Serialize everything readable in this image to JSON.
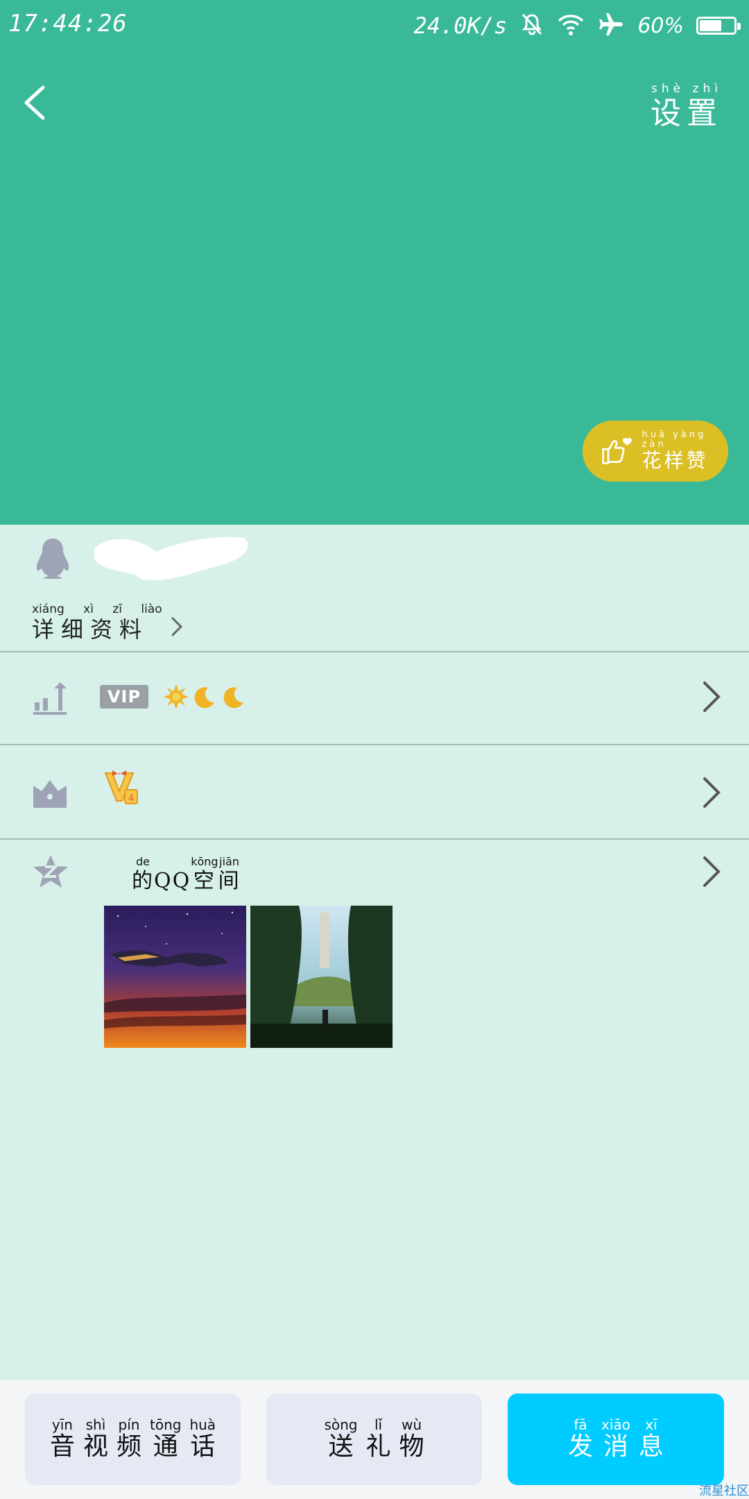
{
  "status_bar": {
    "time": "17:44:26",
    "speed": "24.0K/s",
    "battery_pct": "60%",
    "battery_level": 0.6,
    "icons": [
      "bell-off-icon",
      "wifi-icon",
      "airplane-icon",
      "battery-icon"
    ]
  },
  "header": {
    "settings": {
      "pinyin": "shè zhì",
      "label": "设置"
    },
    "like": {
      "pinyin": "huā yàng zàn",
      "label": "花样赞"
    },
    "colors": {
      "bg": "#39b998",
      "like_bg": "#dcbf25"
    }
  },
  "profile": {
    "detail": {
      "pinyin": "xiáng xì zī liào",
      "label": "详细资料"
    }
  },
  "rows": {
    "vip": {
      "badge": "VIP"
    },
    "qzone": {
      "title": [
        {
          "pinyin": "de",
          "text": "的"
        },
        {
          "pinyin": "",
          "text": "QQ"
        },
        {
          "pinyin": "kōng",
          "text": "空"
        },
        {
          "pinyin": "jiān",
          "text": "间"
        }
      ]
    }
  },
  "bottom": {
    "call": [
      {
        "pinyin": "yīn",
        "text": "音"
      },
      {
        "pinyin": "shì",
        "text": "视"
      },
      {
        "pinyin": "pín",
        "text": "频"
      },
      {
        "pinyin": "tōng",
        "text": "通"
      },
      {
        "pinyin": "huà",
        "text": "话"
      }
    ],
    "gift": [
      {
        "pinyin": "sòng",
        "text": "送"
      },
      {
        "pinyin": "lǐ",
        "text": "礼"
      },
      {
        "pinyin": "wù",
        "text": "物"
      }
    ],
    "message": [
      {
        "pinyin": "fā",
        "text": "发"
      },
      {
        "pinyin": "xiāo",
        "text": "消"
      },
      {
        "pinyin": "xī",
        "text": "息"
      }
    ],
    "colors": {
      "gray": "#e4e9f4",
      "blue": "#00ccff"
    }
  },
  "watermark": "流星社区"
}
